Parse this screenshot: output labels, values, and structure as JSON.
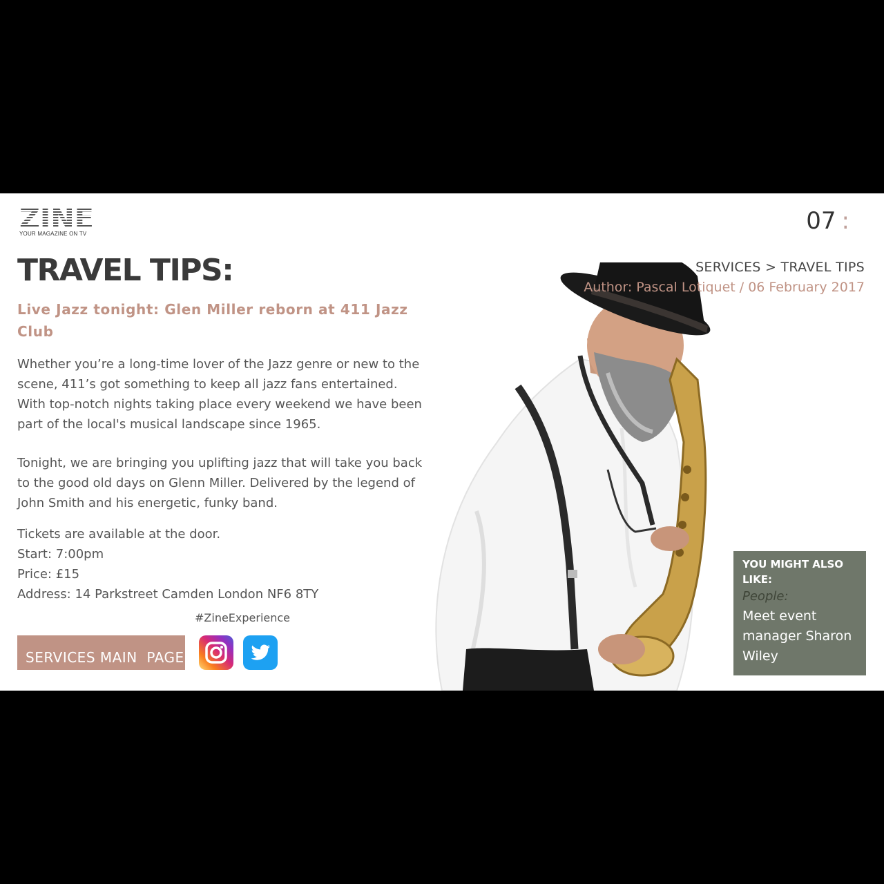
{
  "brand": {
    "logo_text": "ZINE",
    "tagline": "YOUR MAGAZINE ON TV"
  },
  "page": {
    "number": "07",
    "separator": ":"
  },
  "article": {
    "title": "TRAVEL TIPS:",
    "subtitle": " Live Jazz tonight: Glen Miller reborn at 411 Jazz Club",
    "paragraph1": "Whether you’re a long-time lover of the Jazz genre or new to the scene, 411’s got something to keep all jazz fans entertained. With top-notch nights taking place every weekend we have been part of the local's musical landscape since 1965.",
    "paragraph2": "Tonight, we are bringing you uplifting jazz that will take you back to the good old days on Glenn Miller. Delivered by the legend of John Smith and his energetic, funky band.",
    "info": [
      "Tickets are available at the door.",
      "Start: 7:00pm",
      "Price: £15",
      "Address: 14 Parkstreet Camden London NF6 8TY"
    ],
    "hashtag": "#ZineExperience"
  },
  "nav": {
    "breadcrumb": "SERVICES > TRAVEL TIPS",
    "author": "Author: Pascal Lotiquet / 06 February 2017",
    "main_button": "SERVICES MAIN  PAGE"
  },
  "social": [
    {
      "name": "instagram-icon"
    },
    {
      "name": "twitter-icon"
    }
  ],
  "related": {
    "heading": "YOU MIGHT ALSO LIKE:",
    "category": "People:",
    "link": "Meet event manager Sharon Wiley"
  },
  "colors": {
    "accent": "#c09385",
    "title": "#3a3a3a",
    "body": "#555555",
    "related_bg": "#6f776a",
    "letterbox": "#000000"
  }
}
